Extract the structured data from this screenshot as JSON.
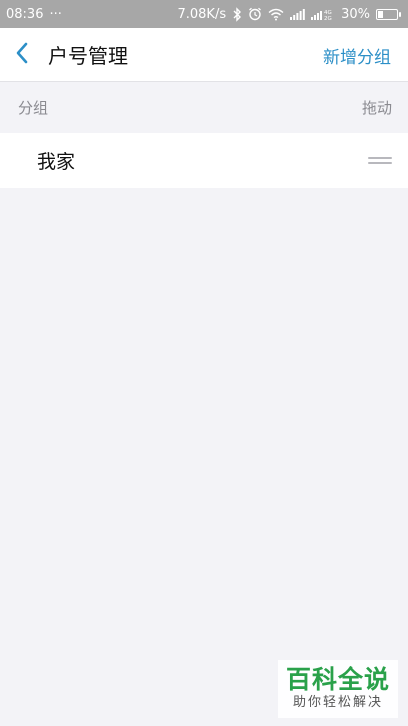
{
  "status_bar": {
    "time": "08:36",
    "more": "···",
    "network_speed": "7.08K/s",
    "battery_percent": "30%",
    "battery_level": 0.3,
    "icons": [
      "bluetooth-icon",
      "alarm-icon",
      "wifi-icon",
      "signal-icon",
      "signal-4g-icon",
      "battery-icon"
    ]
  },
  "header": {
    "back_icon": "chevron-left-icon",
    "title": "户号管理",
    "add_group_label": "新增分组"
  },
  "section": {
    "group_label": "分组",
    "drag_label": "拖动"
  },
  "groups": [
    {
      "label": "我家",
      "handle_icon": "drag-handle-icon"
    }
  ],
  "watermark": {
    "title": "百科全说",
    "subtitle": "助你轻松解决"
  },
  "colors": {
    "accent": "#2c8fc7",
    "background": "#f3f3f7",
    "status_bar": "#a7a7a7",
    "watermark_green": "#2aa14a"
  }
}
